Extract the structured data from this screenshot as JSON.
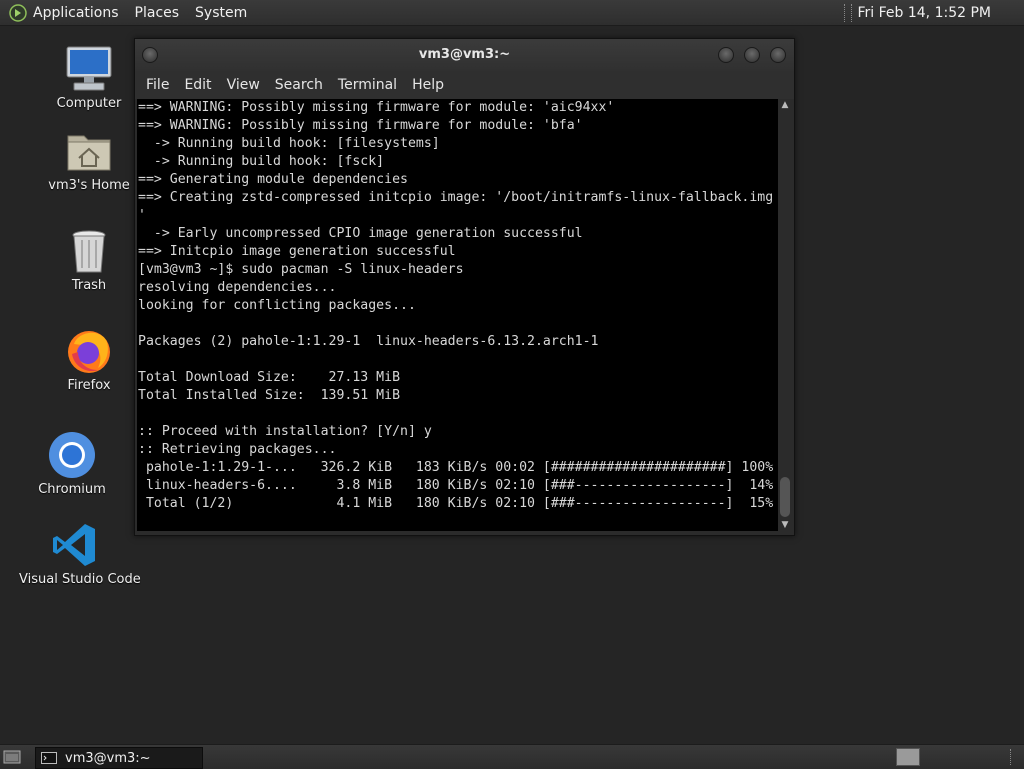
{
  "top_panel": {
    "menu": [
      "Applications",
      "Places",
      "System"
    ],
    "clock": "Fri Feb 14,  1:52 PM"
  },
  "desktop_icons": [
    {
      "label": "Computer",
      "icon": "computer-icon"
    },
    {
      "label": "vm3's Home",
      "icon": "home-folder-icon"
    },
    {
      "label": "Trash",
      "icon": "trash-icon"
    },
    {
      "label": "Firefox",
      "icon": "firefox-icon"
    },
    {
      "label": "Chromium",
      "icon": "chromium-icon"
    },
    {
      "label": "Visual Studio Code",
      "icon": "vscode-icon"
    }
  ],
  "terminal": {
    "title": "vm3@vm3:~",
    "menu": [
      "File",
      "Edit",
      "View",
      "Search",
      "Terminal",
      "Help"
    ],
    "lines": [
      "==> WARNING: Possibly missing firmware for module: 'aic94xx'",
      "==> WARNING: Possibly missing firmware for module: 'bfa'",
      "  -> Running build hook: [filesystems]",
      "  -> Running build hook: [fsck]",
      "==> Generating module dependencies",
      "==> Creating zstd-compressed initcpio image: '/boot/initramfs-linux-fallback.img",
      "'",
      "  -> Early uncompressed CPIO image generation successful",
      "==> Initcpio image generation successful",
      "[vm3@vm3 ~]$ sudo pacman -S linux-headers",
      "resolving dependencies...",
      "looking for conflicting packages...",
      "",
      "Packages (2) pahole-1:1.29-1  linux-headers-6.13.2.arch1-1",
      "",
      "Total Download Size:    27.13 MiB",
      "Total Installed Size:  139.51 MiB",
      "",
      ":: Proceed with installation? [Y/n] y",
      ":: Retrieving packages...",
      " pahole-1:1.29-1-...   326.2 KiB   183 KiB/s 00:02 [######################] 100%",
      " linux-headers-6....     3.8 MiB   180 KiB/s 02:10 [###-------------------]  14%",
      " Total (1/2)             4.1 MiB   180 KiB/s 02:10 [###-------------------]  15%"
    ]
  },
  "bottom_panel": {
    "task_label": "vm3@vm3:~"
  },
  "colors": {
    "desktop_bg": "#252525",
    "terminal_bg": "#000000",
    "terminal_fg": "#d8d8d8"
  }
}
